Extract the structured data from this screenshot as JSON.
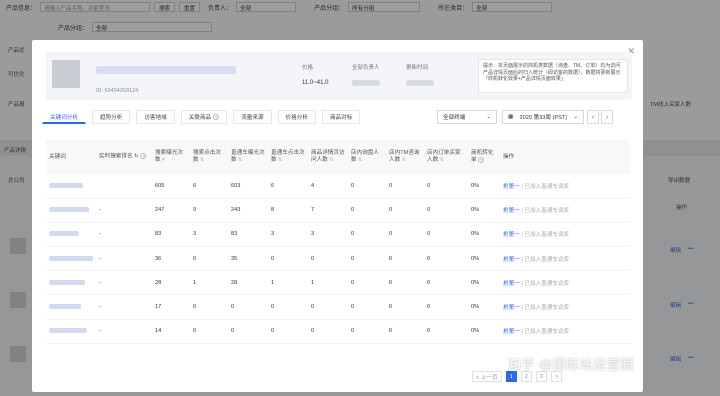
{
  "filters": {
    "product_info_label": "产品信息：",
    "product_info_placeholder": "请输入产品名称、功能型号",
    "search_btn": "搜索",
    "reset_btn": "重置",
    "owner_label": "负责人：",
    "owner_value": "全部",
    "group_label": "产品分组：",
    "group_value": "所有分组",
    "category_label": "所在类目：",
    "category_value": "全部",
    "group2_label": "产品分组：",
    "group2_value": "全部"
  },
  "background": {
    "side_labels": [
      "产品优",
      "可优化",
      "产品报"
    ],
    "details_label": "产品详情",
    "company_label": "总公司",
    "export_label": "导出数据",
    "op_label": "操作",
    "right_col_label": "TM线上买家人数",
    "edit_link": "编辑",
    "more_link": "•••"
  },
  "product": {
    "id_text": "ID: 60494268124",
    "price_label": "价格",
    "price_value": "11.0~41.0",
    "owner_label": "全部负责人",
    "updated_label": "更新时间",
    "tip_text": "提示：本页面展示的商机类数据（询盘、TM、订单）均为访问产品详情页面后的归入统计（即访客的数据），数据将更新展示「商机转化效果+产品详情页面效果」"
  },
  "tabs": [
    "关键词分析",
    "趋势分析",
    "访客地域",
    "关联商品",
    "流量来源",
    "价格分析",
    "商品对标"
  ],
  "active_tab": 0,
  "terminal_select": "全部终端",
  "date_select": "2020 第33周 (PST)",
  "table": {
    "headers": [
      "关键词",
      "实时搜索排名",
      "搜索曝光次数",
      "搜索点击次数",
      "直通车曝光次数",
      "直通车点击次数",
      "商品详情页访问人数",
      "店内询盘人数",
      "店内TM咨询人数",
      "店内订单买家人数",
      "商机转化率",
      "操作"
    ],
    "rows": [
      {
        "rank": "",
        "c1": "605",
        "c2": "6",
        "c3": "603",
        "c4": "6",
        "c5": "4",
        "c6": "0",
        "c7": "0",
        "c8": "0",
        "c9": "0%"
      },
      {
        "rank": "-",
        "c1": "247",
        "c2": "9",
        "c3": "243",
        "c4": "8",
        "c5": "7",
        "c6": "0",
        "c7": "0",
        "c8": "0",
        "c9": "0%"
      },
      {
        "rank": "-",
        "c1": "83",
        "c2": "3",
        "c3": "83",
        "c4": "3",
        "c5": "3",
        "c6": "0",
        "c7": "0",
        "c8": "0",
        "c9": "0%"
      },
      {
        "rank": "-",
        "c1": "36",
        "c2": "0",
        "c3": "35",
        "c4": "0",
        "c5": "0",
        "c6": "0",
        "c7": "0",
        "c8": "0",
        "c9": "0%"
      },
      {
        "rank": "-",
        "c1": "28",
        "c2": "1",
        "c3": "28",
        "c4": "1",
        "c5": "1",
        "c6": "0",
        "c7": "0",
        "c8": "0",
        "c9": "0%"
      },
      {
        "rank": "-",
        "c1": "17",
        "c2": "0",
        "c3": "0",
        "c4": "0",
        "c5": "0",
        "c6": "0",
        "c7": "0",
        "c8": "0",
        "c9": "0%"
      },
      {
        "rank": "-",
        "c1": "14",
        "c2": "0",
        "c3": "0",
        "c4": "0",
        "c5": "0",
        "c6": "0",
        "c7": "0",
        "c8": "0",
        "c9": "0%"
      }
    ],
    "action_primary": "抢第一",
    "action_secondary": "已加入直通车词库"
  },
  "pager": {
    "prev": "< 上一页",
    "current": "1",
    "pages": [
      "2",
      "3"
    ],
    "next": ">"
  },
  "watermark": "知乎 @国际站运营圈",
  "colors": {
    "accent": "#2d6be4",
    "overlay": "rgba(0,0,0,0.38)"
  }
}
